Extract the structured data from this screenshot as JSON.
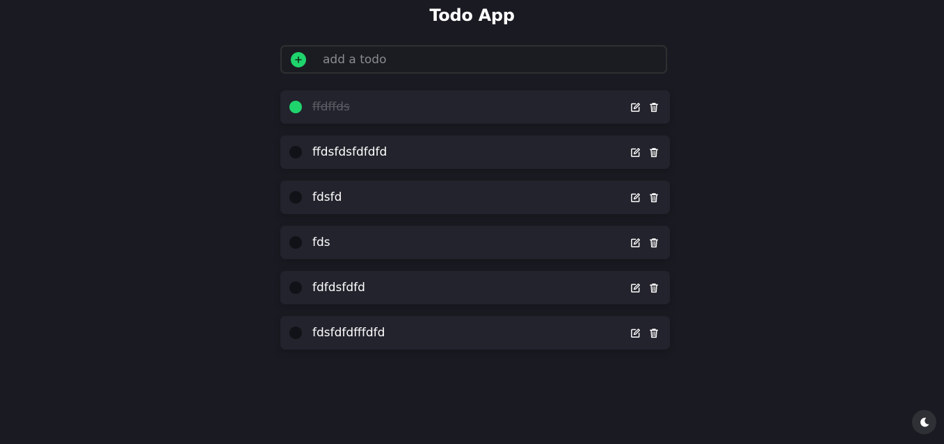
{
  "app": {
    "title": "Todo App"
  },
  "add_todo": {
    "placeholder": "add a todo",
    "value": "",
    "button_icon": "plus-icon"
  },
  "todos": [
    {
      "text": "ffdffds",
      "completed": true
    },
    {
      "text": "ffdsfdsfdfdfd",
      "completed": false
    },
    {
      "text": "fdsfd",
      "completed": false
    },
    {
      "text": "fds",
      "completed": false
    },
    {
      "text": "fdfdsfdfd",
      "completed": false
    },
    {
      "text": "fdsfdfdfffdfd",
      "completed": false
    }
  ],
  "item_icons": {
    "edit": "edit-icon",
    "delete": "trash-icon"
  },
  "theme_toggle": {
    "icon": "moon-icon"
  },
  "colors": {
    "background": "#1a1b22",
    "card": "#22232c",
    "accent": "#1fd46d",
    "completed_text": "#5b5d63"
  }
}
